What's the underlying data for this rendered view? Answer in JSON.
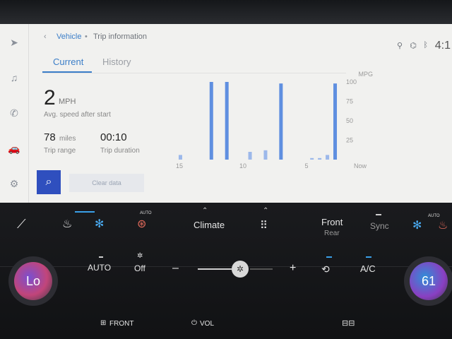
{
  "breadcrumb": {
    "back_symbol": "‹",
    "vehicle": "Vehicle",
    "separator": "•",
    "current": "Trip information"
  },
  "status_bar": {
    "clock": "4:1",
    "icons": [
      "antenna-icon",
      "wifi-icon",
      "bluetooth-icon"
    ]
  },
  "tabs": [
    {
      "label": "Current",
      "active": true
    },
    {
      "label": "History",
      "active": false
    }
  ],
  "stats": {
    "avg_speed_value": "2",
    "avg_speed_unit": "MPH",
    "avg_speed_label": "Avg. speed after start",
    "range_value": "78",
    "range_unit": "miles",
    "range_label": "Trip range",
    "duration_value": "00:10",
    "duration_label": "Trip duration"
  },
  "buttons": {
    "search_icon": "search-icon",
    "clear_label": "Clear data"
  },
  "sidebar": {
    "icons": [
      "navigation-icon",
      "music-icon",
      "phone-icon",
      "car-icon",
      "settings-icon"
    ]
  },
  "chart_data": {
    "type": "bar",
    "title": "",
    "ylabel": "MPG",
    "ylim": [
      0,
      100
    ],
    "y_ticks": [
      "100",
      "75",
      "50",
      "25"
    ],
    "x_ticks": [
      "15",
      "10",
      "5",
      "Now"
    ],
    "values": [
      6,
      0,
      0,
      0,
      100,
      0,
      100,
      0,
      0,
      10,
      0,
      12,
      0,
      98,
      0,
      0,
      0,
      2,
      2,
      6,
      98
    ],
    "colors": {
      "bar": "#9cb8ea",
      "bar_strong": "#5f8fe0"
    }
  },
  "climate": {
    "left_temp": "Lo",
    "right_temp": "61",
    "climate_label": "Climate",
    "front_label": "Front",
    "rear_label": "Rear",
    "sync_label": "Sync",
    "auto_label": "AUTO",
    "fan_off_label": "Off",
    "minus_label": "–",
    "plus_label": "+",
    "ac_label": "A/C",
    "front_defrost_label": "FRONT",
    "vol_label": "VOL",
    "auto_badge": "AUTO",
    "menu_icon": "grid-icon"
  }
}
